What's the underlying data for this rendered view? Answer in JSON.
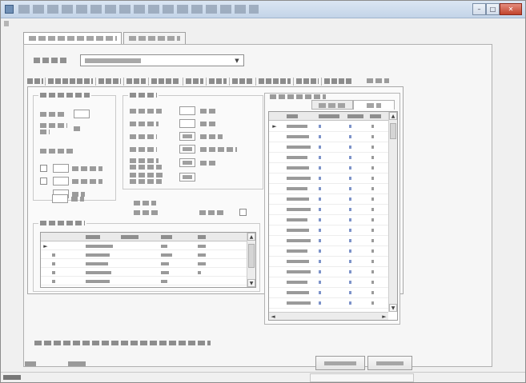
{
  "window": {
    "title": "",
    "controls": {
      "minimize_glyph": "–",
      "maximize_glyph": "□",
      "close_glyph": "✕"
    }
  },
  "icons": {
    "app": "app-icon",
    "scroll_up": "▲",
    "scroll_down": "▼",
    "dropdown": "▼",
    "row_pointer": "►",
    "scroll_right": "►",
    "scroll_left": "◄"
  },
  "menubar": {
    "items": [
      ""
    ]
  },
  "top_tabs": [
    {
      "label": ""
    },
    {
      "label": ""
    }
  ],
  "selector": {
    "label": "",
    "value": ""
  },
  "sub_tabs": [
    "",
    "",
    "",
    "",
    "",
    "",
    "",
    "",
    "",
    "",
    ""
  ],
  "right_indicator": "",
  "groups": {
    "setup": {
      "title": ""
    },
    "limits": {
      "title": ""
    },
    "results": {
      "title": ""
    },
    "right": {
      "title": "",
      "tabs": [
        "",
        ""
      ]
    }
  },
  "results_grid": {
    "columns": [
      "",
      "",
      "",
      "",
      ""
    ],
    "rows": 5
  },
  "right_grid": {
    "columns": [
      "",
      "",
      "",
      ""
    ],
    "rows": 18
  },
  "footer": {
    "note": "",
    "left_a": "",
    "left_b": "",
    "ok_button": "",
    "cancel_button": ""
  },
  "status": {
    "text": ""
  },
  "colors": {
    "accent_blue": "#7d93c9",
    "title_gradient_top": "#dbe6f3",
    "close_red": "#c1432c"
  }
}
